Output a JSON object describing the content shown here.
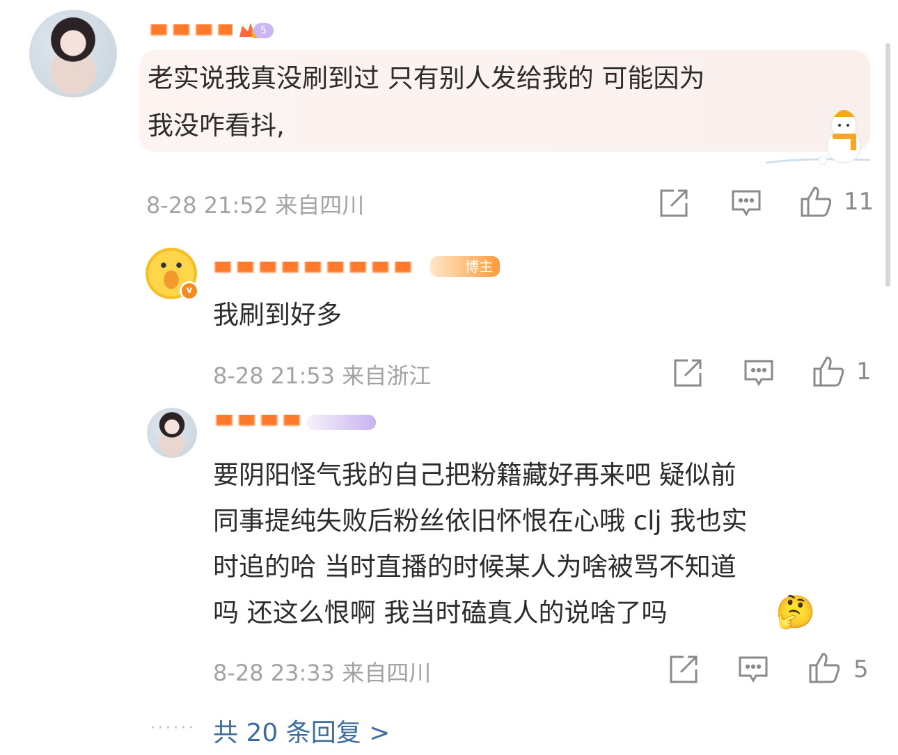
{
  "comments": [
    {
      "text_line1": "老实说我真没刷到过 只有别人发给我的 可能因为",
      "text_line2": "我没咋看抖,",
      "meta": "8-28 21:52 来自四川",
      "likes": "11",
      "badge_label": "5"
    },
    {
      "role_badge": "博主",
      "text": "我刷到好多",
      "meta": "8-28 21:53 来自浙江",
      "likes": "1"
    },
    {
      "text_line1": "要阴阳怪气我的自己把粉籍藏好再来吧 疑似前",
      "text_line2": "同事提纯失败后粉丝依旧怀恨在心哦 clj 我也实",
      "text_line3": "时追的哈 当时直播的时候某人为啥被骂不知道",
      "text_line4": "吗 还这么恨啊 我当时磕真人的说啥了吗",
      "emoji": "🤔",
      "meta": "8-28 23:33 来自四川",
      "likes": "5"
    }
  ],
  "more_replies": "共 20 条回复 >",
  "dots": "······",
  "icons": {
    "repost": "repost-icon",
    "comment": "comment-icon",
    "like": "like-icon"
  }
}
